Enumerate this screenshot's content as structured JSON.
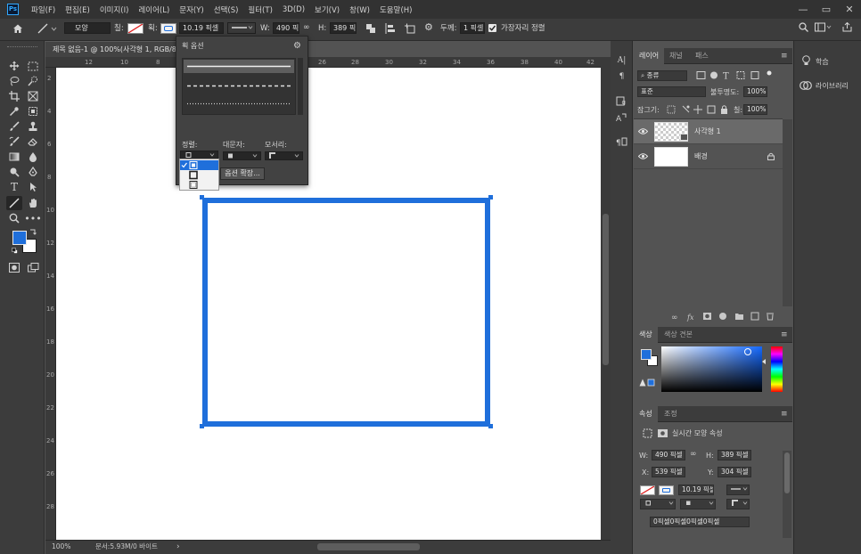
{
  "app": {
    "logo": "Ps",
    "menu": [
      "파일(F)",
      "편집(E)",
      "이미지(I)",
      "레이어(L)",
      "문자(Y)",
      "선택(S)",
      "필터(T)",
      "3D(D)",
      "보기(V)",
      "창(W)",
      "도움말(H)"
    ]
  },
  "options_bar": {
    "mode_value": "모양",
    "fill_label": "칠:",
    "stroke_label": "획:",
    "stroke_width_value": "10.19 픽셀",
    "w_label": "W:",
    "w_value": "490 픽셀",
    "h_label": "H:",
    "h_value": "389 픽셀",
    "thickness_label": "두께:",
    "thickness_value": "1 픽셀",
    "align_edges_label": "가장자리 정렬"
  },
  "document": {
    "tab_title": "제목 없음-1 @ 100%(사각형 1, RGB/8",
    "ruler_h_ticks": [
      "12",
      "10",
      "8",
      "26",
      "28",
      "30",
      "32",
      "34",
      "36",
      "38",
      "40",
      "42"
    ],
    "ruler_v_ticks": [
      "2",
      "4",
      "6",
      "8",
      "10",
      "12",
      "14",
      "16",
      "18",
      "20",
      "22",
      "24",
      "26",
      "28"
    ],
    "zoom": "100%",
    "doc_size": "문서:5.93M/0 바이트"
  },
  "stroke_popup": {
    "title": "획 옵션",
    "align_label": "정렬:",
    "caps_label": "대문자:",
    "corners_label": "모서리:",
    "more_options": "옵션 확장..."
  },
  "layers_panel": {
    "tabs": [
      "레이어",
      "채널",
      "패스"
    ],
    "filter_value": "종류",
    "blend_mode": "표준",
    "opacity_label": "불투명도:",
    "opacity_value": "100%",
    "lock_label": "잠그기:",
    "fill_label": "칠:",
    "fill_value": "100%",
    "layers": [
      {
        "name": "사각형 1",
        "selected": true
      },
      {
        "name": "배경",
        "selected": false
      }
    ]
  },
  "color_panel": {
    "tabs": [
      "색상",
      "색상 견본"
    ],
    "foreground": "#1f6fdb",
    "background": "#ffffff"
  },
  "properties_panel": {
    "tabs": [
      "속성",
      "조정"
    ],
    "title": "실시간 모양 속성",
    "w_label": "W:",
    "w_value": "490 픽셀",
    "h_label": "H:",
    "h_value": "389 픽셀",
    "x_label": "X:",
    "x_value": "539 픽셀",
    "y_label": "Y:",
    "y_value": "304 픽셀",
    "stroke_width_value": "10.19 픽셀",
    "corner_value": "0픽셀0픽셀0픽셀0픽셀"
  },
  "learn_panel": {
    "items": [
      "학습",
      "라이브러리"
    ]
  },
  "colors": {
    "accent": "#1f6fdb"
  }
}
